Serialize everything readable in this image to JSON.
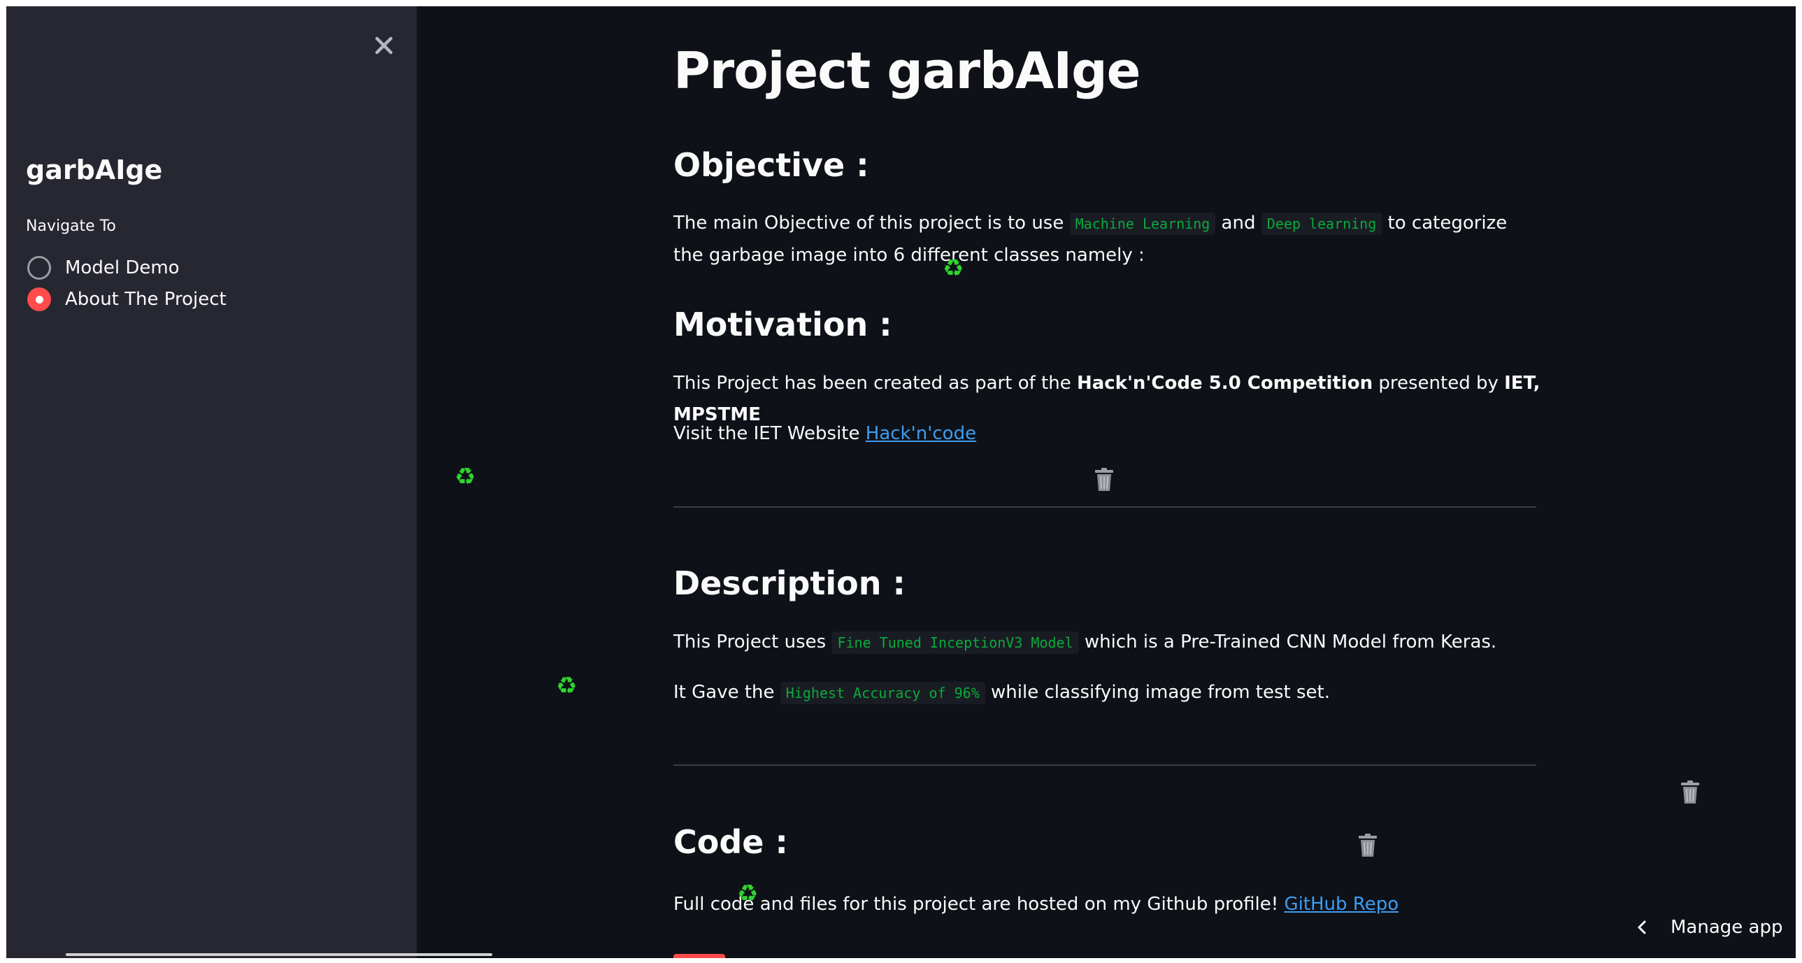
{
  "sidebar": {
    "title": "garbAIge",
    "nav_label": "Navigate To",
    "options": [
      {
        "label": "Model Demo",
        "selected": false
      },
      {
        "label": "About The Project",
        "selected": true
      }
    ],
    "close_icon": "close-icon"
  },
  "main": {
    "title": "Project garbAIge",
    "objective": {
      "heading": "Objective :",
      "text_1": "The main Objective of this project is to use ",
      "code_1": "Machine Learning",
      "text_2": " and ",
      "code_2": "Deep learning",
      "text_3": " to categorize the garbage image into 6 different classes namely :"
    },
    "motivation": {
      "heading": "Motivation :",
      "text_1": "This Project has been created as part of the ",
      "bold_1": "Hack'n'Code 5.0 Competition",
      "text_2": " presented by ",
      "bold_2": "IET, MPSTME",
      "visit_text": "Visit the IET Website ",
      "visit_link": "Hack'n'code"
    },
    "description": {
      "heading": "Description :",
      "text_1": "This Project uses ",
      "code_1": "Fine Tuned InceptionV3 Model",
      "text_2": " which is a Pre-Trained CNN Model from Keras.",
      "text_3": "It Gave the ",
      "code_2": "Highest Accuracy of 96%",
      "text_4": " while classifying image from test set."
    },
    "code": {
      "heading": "Code :",
      "text_1": "Full code and files for this project are hosted on my Github profile! ",
      "link": "GitHub Repo"
    }
  },
  "footer": {
    "manage_app": "Manage app"
  },
  "colors": {
    "background": "#0e1117",
    "sidebar": "#262730",
    "accent": "#ff4b4b",
    "code_text": "#09ab3b",
    "link": "#3d9df3"
  }
}
